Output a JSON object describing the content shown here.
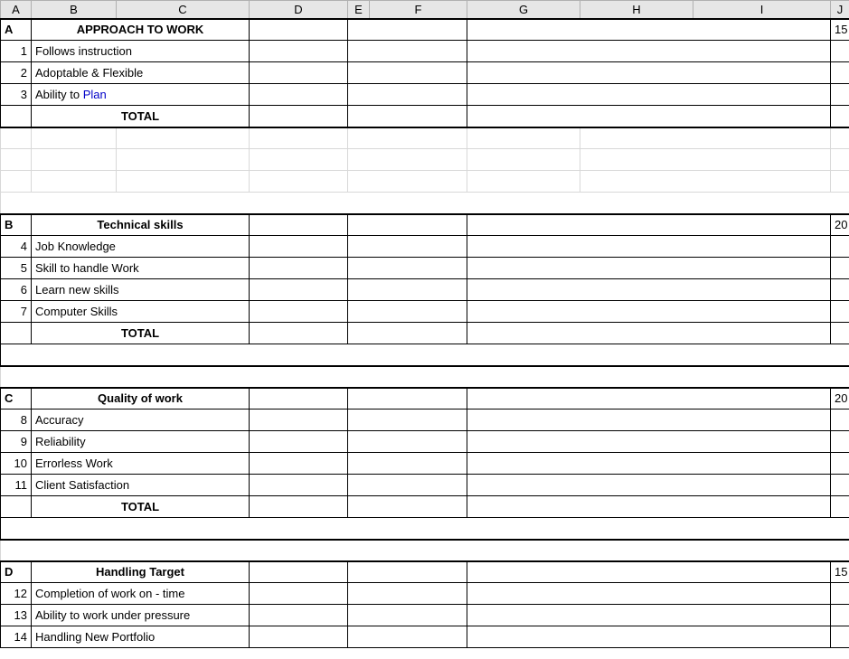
{
  "columns": [
    "A",
    "B",
    "C",
    "D",
    "E",
    "F",
    "G",
    "H",
    "I",
    "J"
  ],
  "sections": {
    "approach": {
      "letter": "A",
      "title": "APPROACH TO WORK",
      "score": 15,
      "items": [
        {
          "num": 1,
          "text": "Follows instruction"
        },
        {
          "num": 2,
          "text": "Adoptable & Flexible"
        },
        {
          "num": 3,
          "text_prefix": "Ability to ",
          "text_link": "Plan"
        }
      ],
      "total": "TOTAL"
    },
    "technical": {
      "letter": "B",
      "title": "Technical skills",
      "score": 20,
      "items": [
        {
          "num": 4,
          "text": "Job Knowledge"
        },
        {
          "num": 5,
          "text": "Skill to handle Work"
        },
        {
          "num": 6,
          "text": "Learn new skills"
        },
        {
          "num": 7,
          "text": "Computer Skills"
        }
      ],
      "total": "TOTAL"
    },
    "quality": {
      "letter": "C",
      "title": "Quality of work",
      "score": 20,
      "items": [
        {
          "num": 8,
          "text": "Accuracy"
        },
        {
          "num": 9,
          "text": "Reliability"
        },
        {
          "num": 10,
          "text": "Errorless Work"
        },
        {
          "num": 11,
          "text": "Client Satisfaction"
        }
      ],
      "total": "TOTAL"
    },
    "handling": {
      "letter": "D",
      "title": "Handling Target",
      "score": 15,
      "items": [
        {
          "num": 12,
          "text": "Completion  of work on - time"
        },
        {
          "num": 13,
          "text": "Ability to work under pressure"
        },
        {
          "num": 14,
          "text": "Handling New Portfolio"
        }
      ]
    }
  }
}
